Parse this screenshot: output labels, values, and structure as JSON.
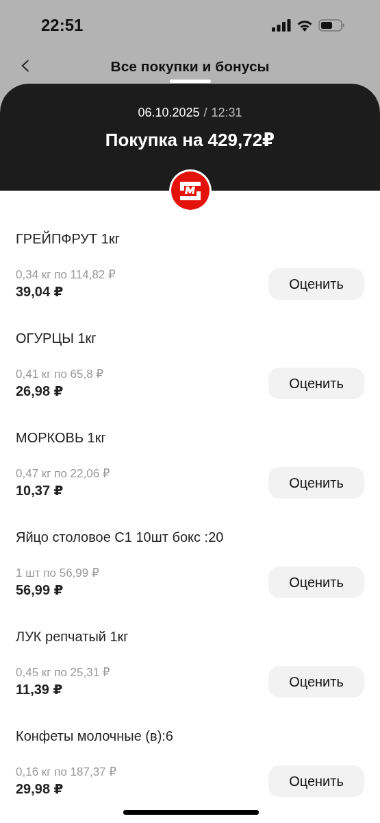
{
  "status_bar": {
    "time": "22:51"
  },
  "nav": {
    "back": "‹",
    "title": "Все покупки и бонусы"
  },
  "header": {
    "date": "06.10.2025",
    "separator": "/",
    "time": "12:31",
    "title": "Покупка на 429,72₽"
  },
  "items": [
    {
      "name": "ГРЕЙПФРУТ 1кг",
      "unit_price": "0,34 кг по 114,82 ₽",
      "total": "39,04 ₽",
      "button": "Оценить"
    },
    {
      "name": "ОГУРЦЫ 1кг",
      "unit_price": "0,41 кг по 65,8 ₽",
      "total": "26,98 ₽",
      "button": "Оценить"
    },
    {
      "name": "МОРКОВЬ 1кг",
      "unit_price": "0,47 кг по 22,06 ₽",
      "total": "10,37 ₽",
      "button": "Оценить"
    },
    {
      "name": "Яйцо столовое С1 10шт бокс :20",
      "unit_price": "1 шт по 56,99 ₽",
      "total": "56,99 ₽",
      "button": "Оценить"
    },
    {
      "name": "ЛУК репчатый 1кг",
      "unit_price": "0,45 кг по 25,31 ₽",
      "total": "11,39 ₽",
      "button": "Оценить"
    },
    {
      "name": "Конфеты молочные (в):6",
      "unit_price": "0,16 кг по 187,37 ₽",
      "total": "29,98 ₽",
      "button": "Оценить"
    }
  ]
}
